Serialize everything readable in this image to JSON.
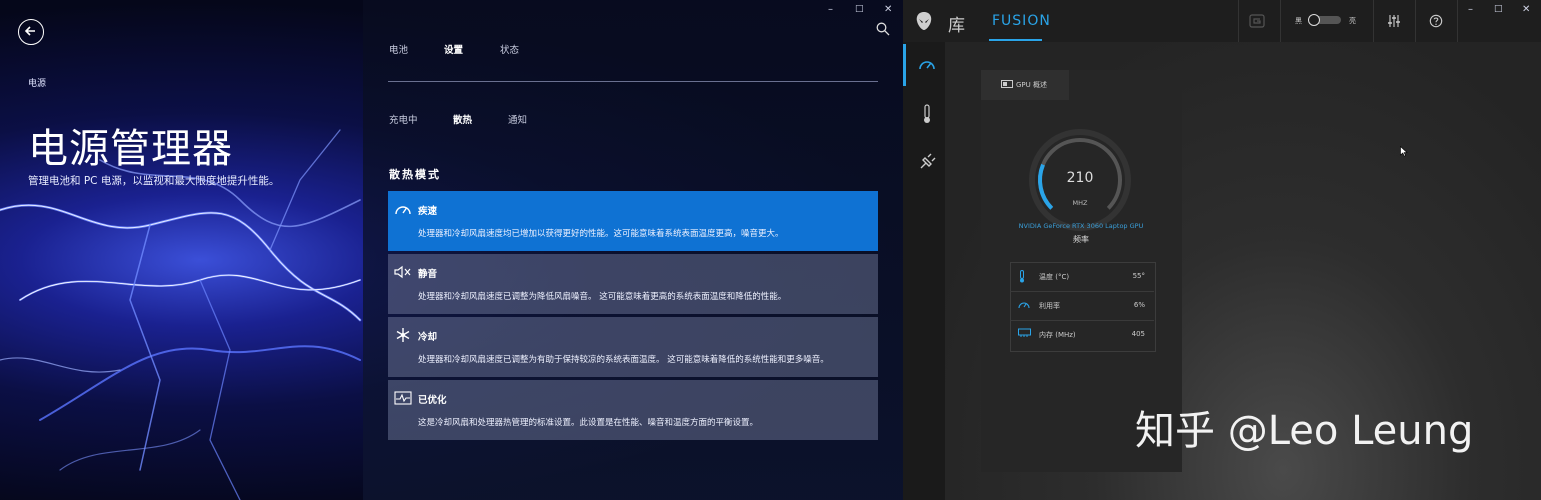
{
  "power_manager": {
    "breadcrumb": "电源",
    "title": "电源管理器",
    "subtitle": "管理电池和 PC 电源，以监视和最大限度地提升性能。",
    "window_controls": [
      "–",
      "□",
      "✕"
    ],
    "tabs": [
      {
        "label": "电池",
        "active": false
      },
      {
        "label": "设置",
        "active": true
      },
      {
        "label": "状态",
        "active": false
      }
    ],
    "subtabs": [
      {
        "label": "充电中",
        "active": false
      },
      {
        "label": "散热",
        "active": true
      },
      {
        "label": "通知",
        "active": false
      }
    ],
    "section_title": "散热模式",
    "modes": [
      {
        "icon": "gauge-icon",
        "title": "疾速",
        "desc": "处理器和冷却风扇速度均已增加以获得更好的性能。这可能意味着系统表面温度更高，噪音更大。",
        "selected": true
      },
      {
        "icon": "mute-icon",
        "title": "静音",
        "desc": "处理器和冷却风扇速度已调整为降低风扇噪音。 这可能意味着更高的系统表面温度和降低的性能。",
        "selected": false
      },
      {
        "icon": "snowflake-icon",
        "title": "冷却",
        "desc": "处理器和冷却风扇速度已调整为有助于保持较凉的系统表面温度。 这可能意味着降低的系统性能和更多噪音。",
        "selected": false
      },
      {
        "icon": "pulse-icon",
        "title": "已优化",
        "desc": "这是冷却风扇和处理器热管理的标准设置。此设置是在性能、噪音和温度方面的平衡设置。",
        "selected": false
      }
    ]
  },
  "fusion": {
    "library_label": "库",
    "fusion_tab": "FUSION",
    "toggle_left": "黑",
    "toggle_right": "亮",
    "window_controls": [
      "–",
      "□",
      "✕"
    ],
    "gpu_tab": "GPU 概述",
    "gauge_value": "210",
    "gauge_fraction": 0.25,
    "gauge_unit": "MHZ",
    "gpu_name": "NVIDIA GeForce RTX 3060 Laptop GPU",
    "metric_label": "频率",
    "stats": [
      {
        "icon": "thermometer-icon",
        "label": "温度 (°C)",
        "value": "55°"
      },
      {
        "icon": "gauge-icon",
        "label": "利用率",
        "value": "6%"
      },
      {
        "icon": "memory-icon",
        "label": "内存 (MHz)",
        "value": "405"
      }
    ],
    "accent": "#2aa4e8"
  },
  "watermark": "知乎 @Leo Leung"
}
